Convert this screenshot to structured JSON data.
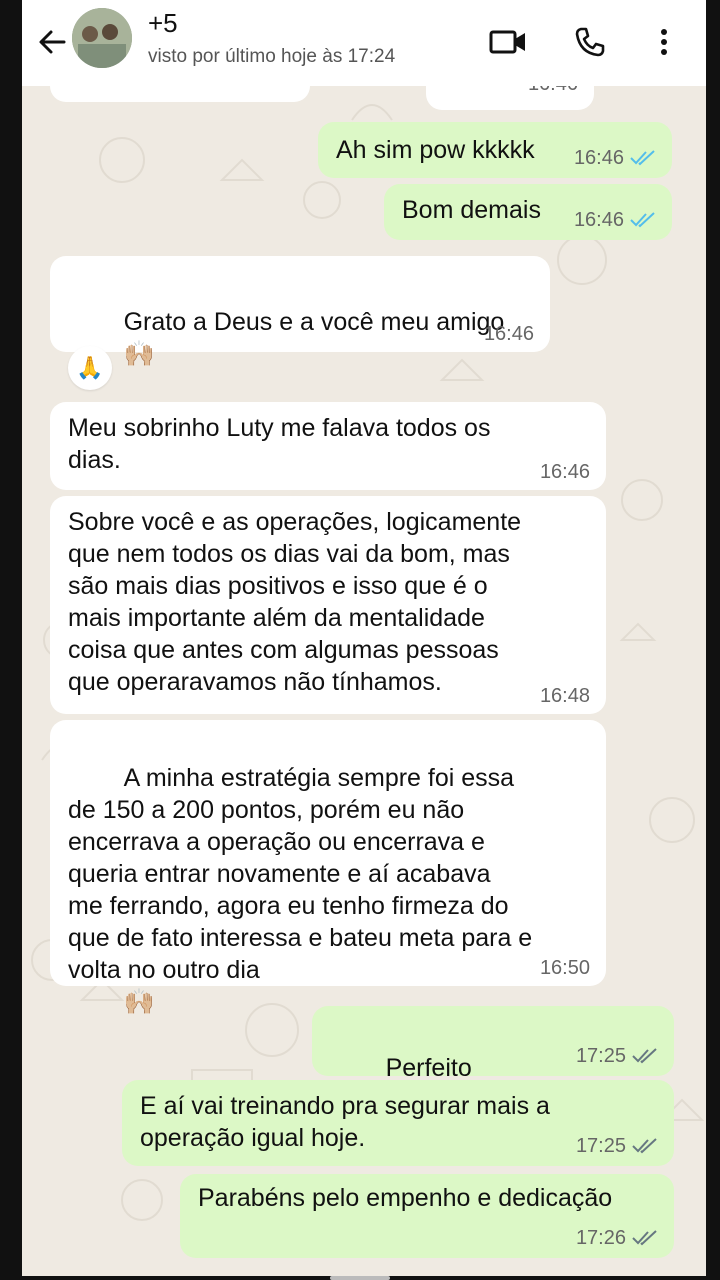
{
  "header": {
    "contact_name": "+5",
    "last_seen": "visto por último hoje às 17:24"
  },
  "messages": [
    {
      "dir": "in",
      "text": "",
      "time": "16:46"
    },
    {
      "dir": "out",
      "text": "Ah sim pow kkkkk",
      "time": "16:46",
      "status": "read"
    },
    {
      "dir": "out",
      "text": "Bom demais",
      "time": "16:46",
      "status": "read"
    },
    {
      "dir": "in",
      "text": "Grato a Deus e a você meu amigo",
      "emoji": "🙌🏼",
      "time": "16:46"
    },
    {
      "dir": "in",
      "text": "Meu sobrinho Luty me falava todos os\ndias.",
      "time": "16:46"
    },
    {
      "dir": "in",
      "text": "Sobre você e as operações, logicamente\nque nem todos os dias vai da bom, mas\nsão mais dias positivos e isso que é o\nmais importante além da mentalidade\ncoisa que antes com algumas pessoas\nque operaravamos não tínhamos.",
      "time": "16:48"
    },
    {
      "dir": "in",
      "text": "A minha estratégia sempre foi essa\nde 150 a 200 pontos, porém eu não\nencerrava a operação ou encerrava e\nqueria entrar novamente e aí acabava\nme ferrando, agora eu tenho firmeza do\nque de fato interessa e bateu meta para e\nvolta no outro dia",
      "emoji": "🙌🏼",
      "time": "16:50"
    },
    {
      "dir": "out",
      "text": "Perfeito",
      "emoji": "👏🏼👏🏼👏🏼",
      "time": "17:25",
      "status": "delivered"
    },
    {
      "dir": "out",
      "text": "E aí vai treinando pra segurar mais a\noperação igual hoje.",
      "time": "17:25",
      "status": "delivered"
    },
    {
      "dir": "out",
      "text": "Parabéns pelo empenho e dedicação",
      "time": "17:26",
      "status": "delivered"
    }
  ],
  "reaction": "🙏",
  "colors": {
    "header_bg": "#ffffff",
    "chat_bg": "#efeae2",
    "incoming_bubble": "#ffffff",
    "outgoing_bubble": "#dcf8c6",
    "read_tick": "#53bdeb",
    "delivered_tick": "#667781",
    "icon": "#111111"
  },
  "icons": [
    "back-arrow-icon",
    "avatar",
    "video-call-icon",
    "phone-icon",
    "more-options-icon",
    "double-check-icon",
    "prayer-hands-emoji"
  ]
}
